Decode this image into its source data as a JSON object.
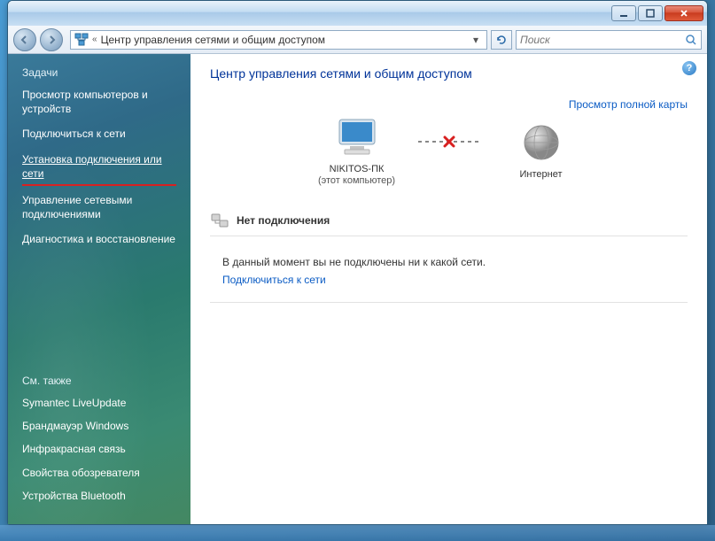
{
  "addressbar": {
    "chevron": "«",
    "title": "Центр управления сетями и общим доступом"
  },
  "search": {
    "placeholder": "Поиск"
  },
  "sidebar": {
    "heading": "Задачи",
    "tasks": [
      "Просмотр компьютеров и устройств",
      "Подключиться к сети",
      "Установка подключения или сети",
      "Управление сетевыми подключениями",
      "Диагностика и восстановление"
    ],
    "see_also_heading": "См. также",
    "see_also": [
      "Symantec LiveUpdate",
      "Брандмауэр Windows",
      "Инфракрасная связь",
      "Свойства обозревателя",
      "Устройства Bluetooth"
    ]
  },
  "content": {
    "title": "Центр управления сетями и общим доступом",
    "view_full_map": "Просмотр полной карты",
    "computer_name": "NIKITOS-ПК",
    "computer_sub": "(этот компьютер)",
    "internet_label": "Интернет",
    "status_text": "Нет подключения",
    "message": "В данный момент вы не подключены ни к какой сети.",
    "connect_link": "Подключиться к сети"
  }
}
